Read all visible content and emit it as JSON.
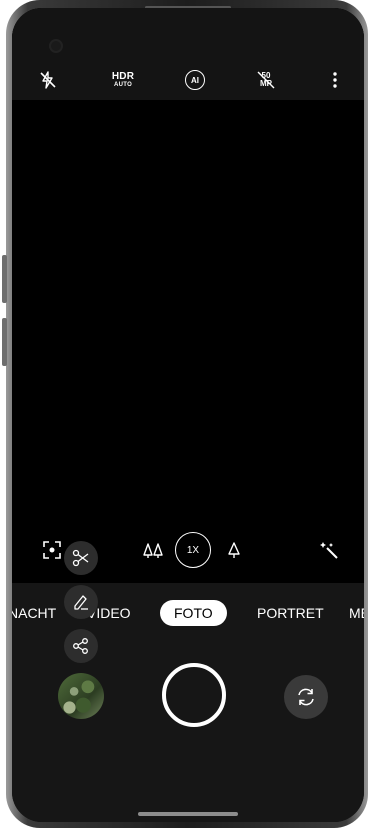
{
  "top_bar": {
    "flash": {
      "icon": "flash-off-icon"
    },
    "hdr": {
      "label": "HDR",
      "sub": "AUTO"
    },
    "ai": {
      "label": "AI"
    },
    "mp": {
      "top": "50",
      "bottom": "MP"
    },
    "more": {
      "icon": "more-vertical-icon"
    }
  },
  "zoom": {
    "left_icon": "wide-angle-trees-icon",
    "level": "1X",
    "right_icon": "tele-tree-icon"
  },
  "side_tools": {
    "scan": {
      "icon": "focus-scan-icon"
    },
    "cut": {
      "icon": "scissors-icon"
    },
    "edit": {
      "icon": "pen-icon"
    },
    "share": {
      "icon": "share-icon"
    },
    "magic": {
      "icon": "magic-wand-icon"
    }
  },
  "modes": [
    {
      "label": "NACHT"
    },
    {
      "label": "VIDEO"
    },
    {
      "label": "FOTO",
      "active": true
    },
    {
      "label": "PORTRET"
    },
    {
      "label": "MEER"
    }
  ],
  "controls": {
    "thumbnail": "last-photo-thumbnail",
    "shutter": "shutter-button",
    "flip": "switch-camera-icon"
  },
  "colors": {
    "accent": "#ffffff",
    "background": "#000000",
    "panel": "#161616"
  }
}
